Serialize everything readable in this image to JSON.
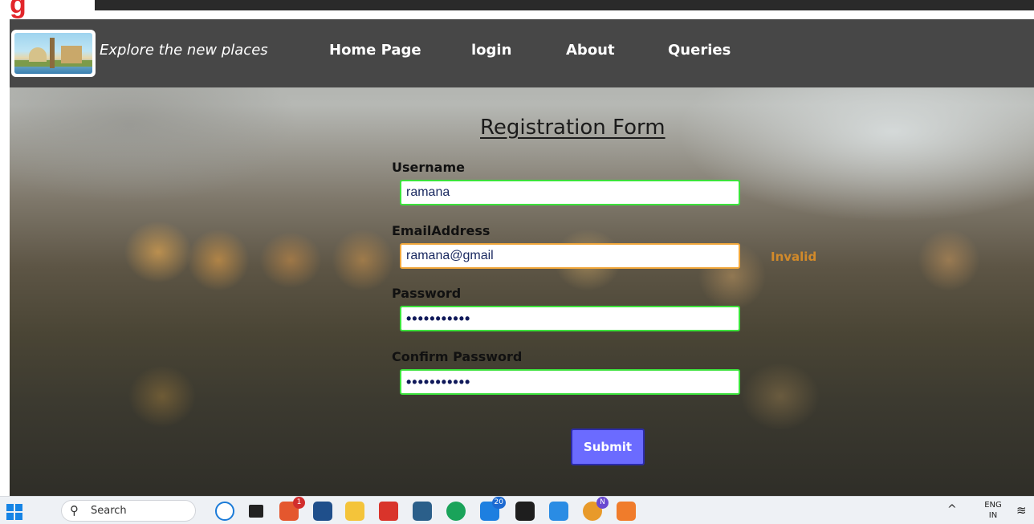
{
  "header": {
    "brand_text": "Explore the new places",
    "nav": [
      {
        "label": "Home Page"
      },
      {
        "label": "login"
      },
      {
        "label": "About"
      },
      {
        "label": "Queries"
      }
    ]
  },
  "form": {
    "title": "Registration Form",
    "username_label": "Username",
    "username_value": "ramana",
    "email_label": "EmailAddress",
    "email_value": "ramana@gmail",
    "email_status": "Invalid",
    "password_label": "Password",
    "password_value": "•••••••••••",
    "confirm_label": "Confirm Password",
    "confirm_value": "•••••••••••",
    "submit_label": "Submit"
  },
  "taskbar": {
    "search_placeholder": "Search",
    "badges": [
      "1",
      "20",
      "N"
    ],
    "lang_line1": "ENG",
    "lang_line2": "IN"
  },
  "colors": {
    "navbar": "#474747",
    "valid_border": "#3ce23c",
    "warn_border": "#f0a63a",
    "invalid_text": "#d28a2a",
    "submit_bg": "#6b6bff"
  }
}
